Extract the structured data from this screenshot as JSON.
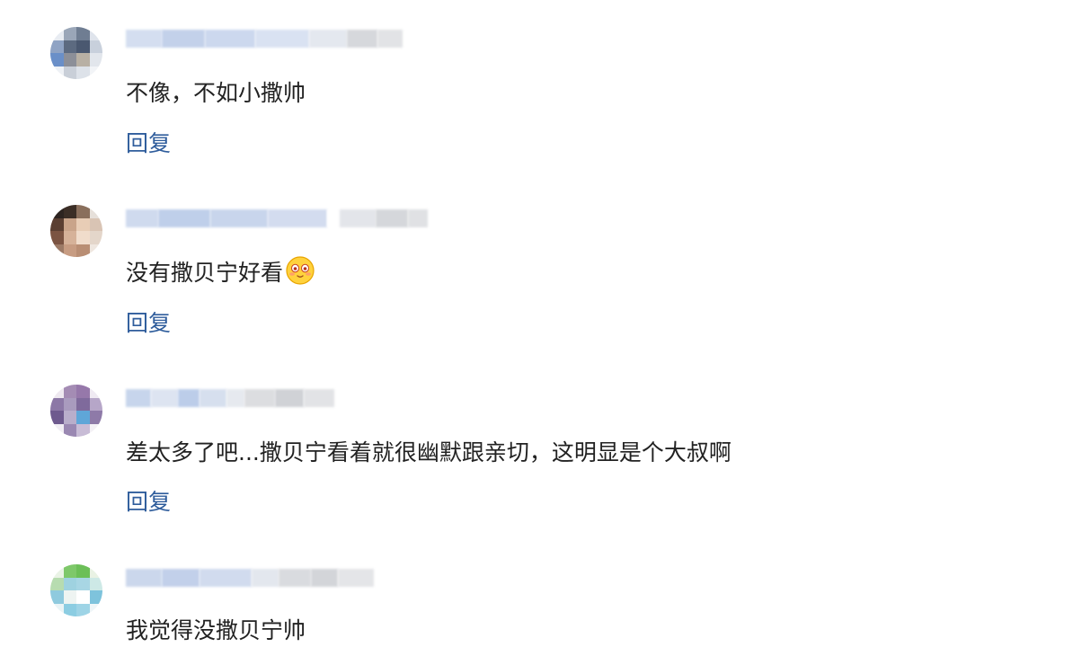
{
  "comments": [
    {
      "text": "不像，不如小撒帅",
      "reply_label": "回复"
    },
    {
      "text": "没有撒贝宁好看",
      "emoji": "blush-face-emoji",
      "reply_label": "回复"
    },
    {
      "text": "差太多了吧...撒贝宁看着就很幽默跟亲切，这明显是个大叔啊",
      "reply_label": "回复"
    },
    {
      "text": "我觉得没撒贝宁帅"
    }
  ],
  "colors": {
    "reply_link": "#2f5d9c",
    "comment_text": "#222222"
  }
}
